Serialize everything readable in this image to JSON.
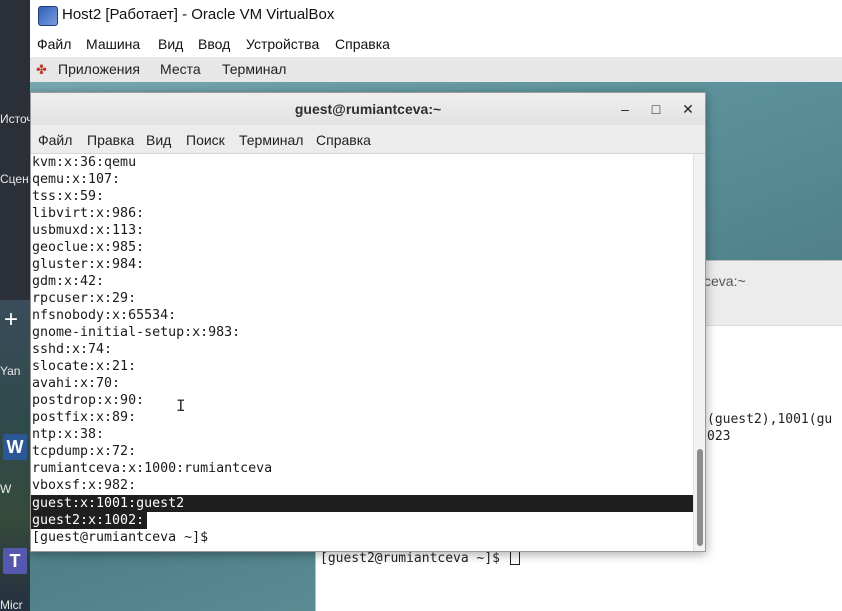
{
  "host": {
    "labels": [
      "Источ",
      "Сцен",
      "Yan",
      "W",
      "Micr"
    ],
    "plus": "+",
    "word_icon": "W",
    "teams_icon": "T"
  },
  "vbox": {
    "title": "Host2 [Работает] - Oracle VM VirtualBox",
    "menu": [
      "Файл",
      "Машина",
      "Вид",
      "Ввод",
      "Устройства",
      "Справка"
    ]
  },
  "gnome": {
    "items": [
      "Приложения",
      "Места",
      "Терминал"
    ]
  },
  "bg_terminal": {
    "title_partial": "ceva:~",
    "lines": [
      "(guest2),1001(gu",
      "023"
    ],
    "prompt": "[guest2@rumiantceva ~]$ "
  },
  "terminal": {
    "title": "guest@rumiantceva:~",
    "buttons": [
      "–",
      "□",
      "✕"
    ],
    "menu": [
      "Файл",
      "Правка",
      "Вид",
      "Поиск",
      "Терминал",
      "Справка"
    ],
    "lines": [
      "kvm:x:36:qemu",
      "qemu:x:107:",
      "tss:x:59:",
      "libvirt:x:986:",
      "usbmuxd:x:113:",
      "geoclue:x:985:",
      "gluster:x:984:",
      "gdm:x:42:",
      "rpcuser:x:29:",
      "nfsnobody:x:65534:",
      "gnome-initial-setup:x:983:",
      "sshd:x:74:",
      "slocate:x:21:",
      "avahi:x:70:",
      "postdrop:x:90:",
      "postfix:x:89:",
      "ntp:x:38:",
      "tcpdump:x:72:",
      "rumiantceva:x:1000:rumiantceva",
      "vboxsf:x:982:",
      "guest:x:1001:guest2",
      "guest2:x:1002:",
      "[guest@rumiantceva ~]$ "
    ]
  },
  "colors": {
    "selection_bg": "#1f1f1f",
    "selection_fg": "#ffffff",
    "desktop": "#5a8f99"
  }
}
